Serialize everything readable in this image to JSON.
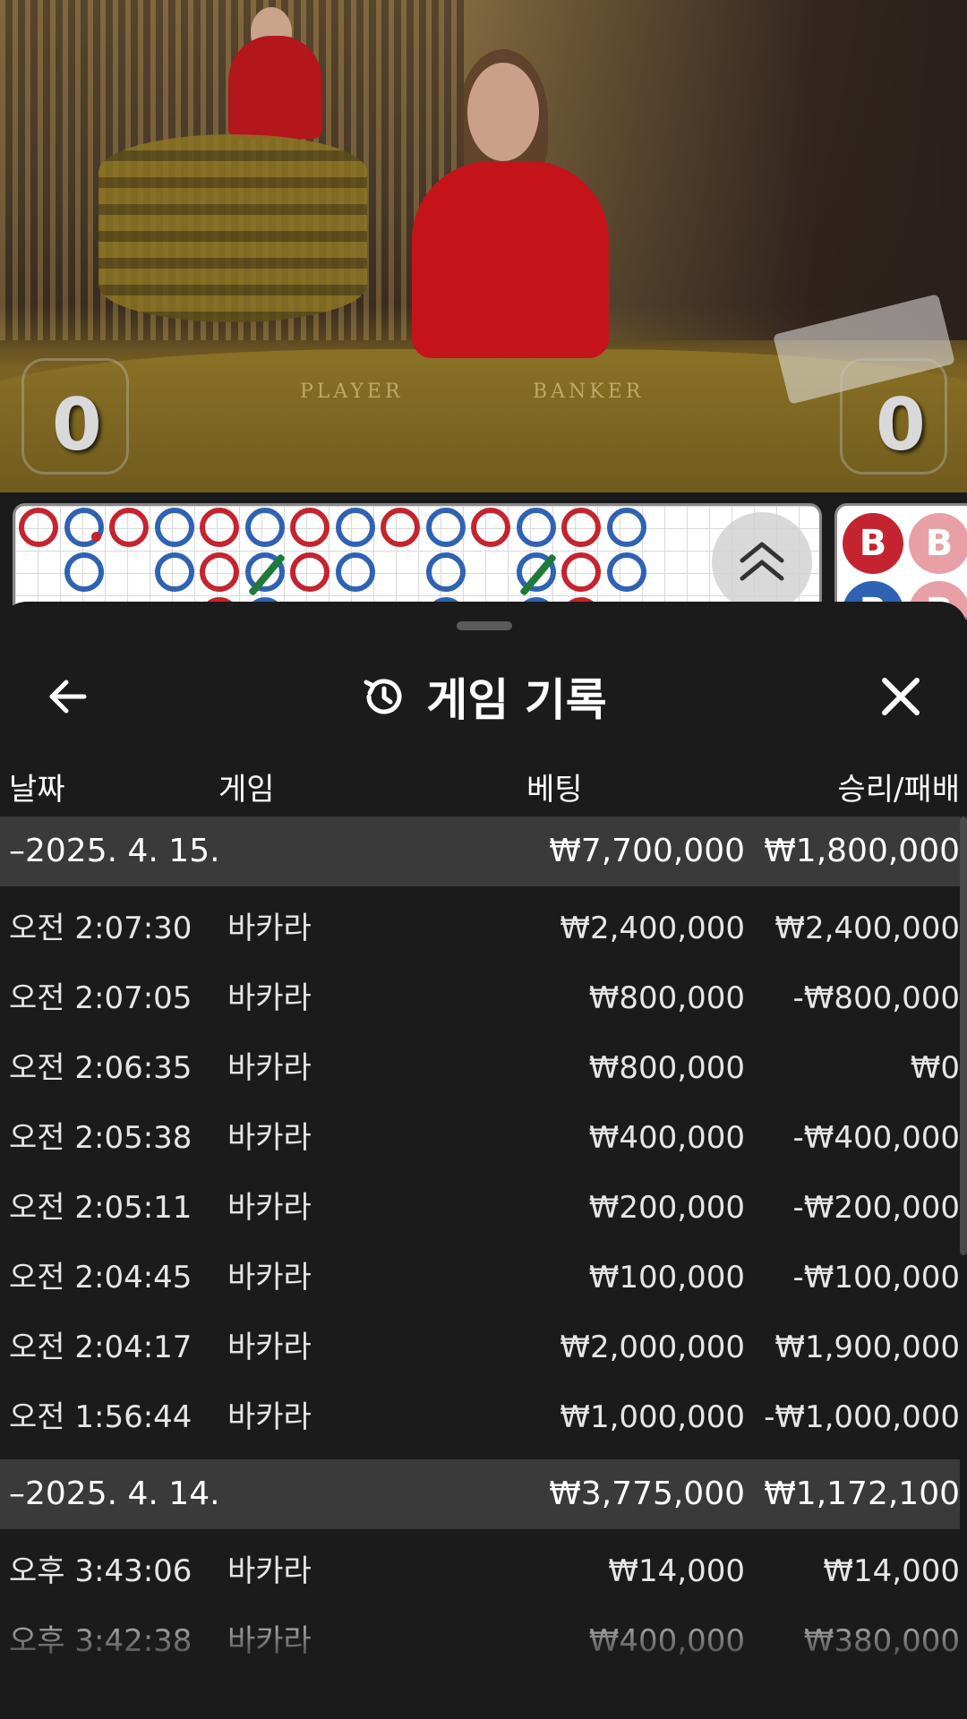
{
  "video": {
    "player_score": "0",
    "banker_score": "0",
    "table_label_player": "PLAYER",
    "table_label_banker": "BANKER"
  },
  "roadmap": {
    "beads_top": [
      "r",
      "b",
      "r",
      "b",
      "r",
      "b",
      "r",
      "b",
      "r",
      "b",
      "r",
      "b",
      "r",
      "b"
    ],
    "right_badges": [
      "B",
      "B",
      "B",
      "B"
    ]
  },
  "history_sheet": {
    "title": "게임 기록",
    "back_icon": "arrow-left-icon",
    "history_icon": "history-clock-icon",
    "close_icon": "close-icon",
    "columns": {
      "date": "날짜",
      "game": "게임",
      "bet": "베팅",
      "win_loss": "승리/패배"
    },
    "groups": [
      {
        "date": "–2025. 4. 15.",
        "total_bet": "₩7,700,000",
        "total_win_loss": "₩1,800,000",
        "rows": [
          {
            "time": "오전 2:07:30",
            "game": "바카라",
            "bet": "₩2,400,000",
            "win_loss": "₩2,400,000"
          },
          {
            "time": "오전 2:07:05",
            "game": "바카라",
            "bet": "₩800,000",
            "win_loss": "-₩800,000"
          },
          {
            "time": "오전 2:06:35",
            "game": "바카라",
            "bet": "₩800,000",
            "win_loss": "₩0"
          },
          {
            "time": "오전 2:05:38",
            "game": "바카라",
            "bet": "₩400,000",
            "win_loss": "-₩400,000"
          },
          {
            "time": "오전 2:05:11",
            "game": "바카라",
            "bet": "₩200,000",
            "win_loss": "-₩200,000"
          },
          {
            "time": "오전 2:04:45",
            "game": "바카라",
            "bet": "₩100,000",
            "win_loss": "-₩100,000"
          },
          {
            "time": "오전 2:04:17",
            "game": "바카라",
            "bet": "₩2,000,000",
            "win_loss": "₩1,900,000"
          },
          {
            "time": "오전 1:56:44",
            "game": "바카라",
            "bet": "₩1,000,000",
            "win_loss": "-₩1,000,000"
          }
        ]
      },
      {
        "date": "–2025. 4. 14.",
        "total_bet": "₩3,775,000",
        "total_win_loss": "₩1,172,100",
        "rows": [
          {
            "time": "오후 3:43:06",
            "game": "바카라",
            "bet": "₩14,000",
            "win_loss": "₩14,000"
          },
          {
            "time": "오후 3:42:38",
            "game": "바카라",
            "bet": "₩400,000",
            "win_loss": "₩380,000"
          }
        ]
      }
    ]
  },
  "colors": {
    "sheet_bg": "#1b1b1b",
    "date_row_bg": "#3a3a3a",
    "banker_red": "#c4242f",
    "player_blue": "#2f62b3",
    "tie_green": "#1f7a3a"
  }
}
